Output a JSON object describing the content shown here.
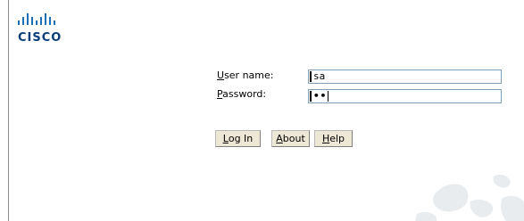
{
  "logo": {
    "text": "CISCO"
  },
  "form": {
    "username_label_first": "U",
    "username_label_rest": "ser name:",
    "username_value": "sa",
    "password_label_first": "P",
    "password_label_rest": "assword:",
    "password_masked": "••"
  },
  "buttons": {
    "login_first": "L",
    "login_rest": "og In",
    "about_first": "A",
    "about_rest": "bout",
    "help_first": "H",
    "help_rest": "elp"
  },
  "colors": {
    "logo_blue": "#0a3e7a",
    "field_border": "#7f9db9",
    "button_face": "#ede7d6"
  },
  "icons": [
    "cisco-logo-bars-icon",
    "world-map-watermark-icon"
  ]
}
